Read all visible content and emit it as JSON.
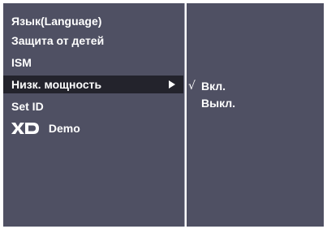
{
  "left_menu": {
    "items": [
      {
        "label": "Язык(Language)"
      },
      {
        "label": "Защита от детей"
      },
      {
        "label": "ISM"
      },
      {
        "label": "Низк. мощность"
      },
      {
        "label": "Set ID"
      },
      {
        "label": "Demo",
        "logo_text": "XD"
      }
    ],
    "selected_index": 3
  },
  "submenu": {
    "check_mark": "√",
    "options": [
      {
        "label": "Вкл.",
        "checked": true
      },
      {
        "label": "Выкл.",
        "checked": false
      }
    ]
  },
  "colors": {
    "panel_bg": "#4f5063",
    "highlight_bg": "#23232c",
    "text": "#ffffff"
  }
}
